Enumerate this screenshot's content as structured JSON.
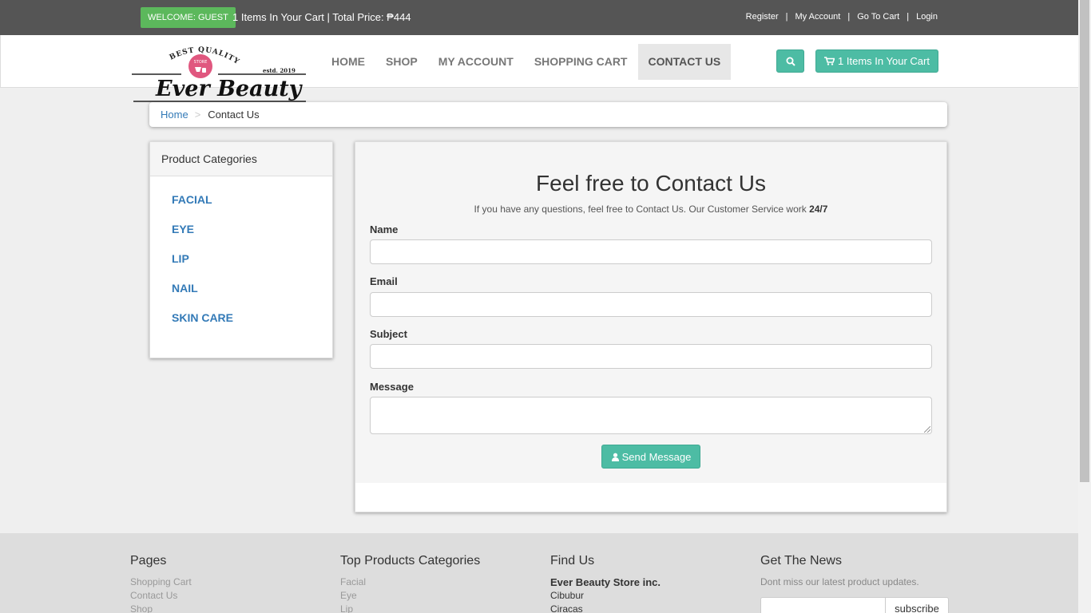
{
  "topbar": {
    "welcome": "WELCOME: GUEST",
    "cart_info": "1 Items In Your Cart | Total Price: ₱444",
    "links": [
      "Register",
      "My Account",
      "Go To Cart",
      "Login"
    ]
  },
  "logo": {
    "tagline": "BEST QUALITY",
    "store": "STORE",
    "name": "Ever Beauty",
    "established": "estd. 2019"
  },
  "nav": {
    "items": [
      "HOME",
      "SHOP",
      "MY ACCOUNT",
      "SHOPPING CART",
      "CONTACT US"
    ],
    "active": "CONTACT US",
    "search_icon": "search-icon",
    "cart_button": "1 Items In Your Cart"
  },
  "breadcrumb": {
    "home": "Home",
    "separator": ">",
    "current": "Contact Us"
  },
  "categories": {
    "title": "Product Categories",
    "items": [
      "FACIAL",
      "EYE",
      "LIP",
      "NAIL",
      "SKIN CARE"
    ]
  },
  "contact": {
    "title": "Feel free to Contact Us",
    "subtitle": "If you have any questions, feel free to Contact Us. Our Customer Service work",
    "subtitle_bold": "24/7",
    "fields": {
      "name_label": "Name",
      "email_label": "Email",
      "subject_label": "Subject",
      "message_label": "Message",
      "name_value": "",
      "email_value": "",
      "subject_value": "",
      "message_value": ""
    },
    "send_button": "Send Message"
  },
  "footer": {
    "pages": {
      "title": "Pages",
      "links": [
        "Shopping Cart",
        "Contact Us",
        "Shop"
      ]
    },
    "top_categories": {
      "title": "Top Products Categories",
      "links": [
        "Facial",
        "Eye",
        "Lip"
      ]
    },
    "find_us": {
      "title": "Find Us",
      "company": "Ever Beauty Store inc.",
      "lines": [
        "Cibubur",
        "Ciracas"
      ]
    },
    "news": {
      "title": "Get The News",
      "text": "Dont miss our latest product updates.",
      "input_value": "",
      "button": "subscribe"
    }
  },
  "colors": {
    "topbar_bg": "#555555",
    "welcome_badge": "#5cb85c",
    "accent": "#4dbca4",
    "link": "#337ab7",
    "logo_pink": "#e0577f"
  }
}
